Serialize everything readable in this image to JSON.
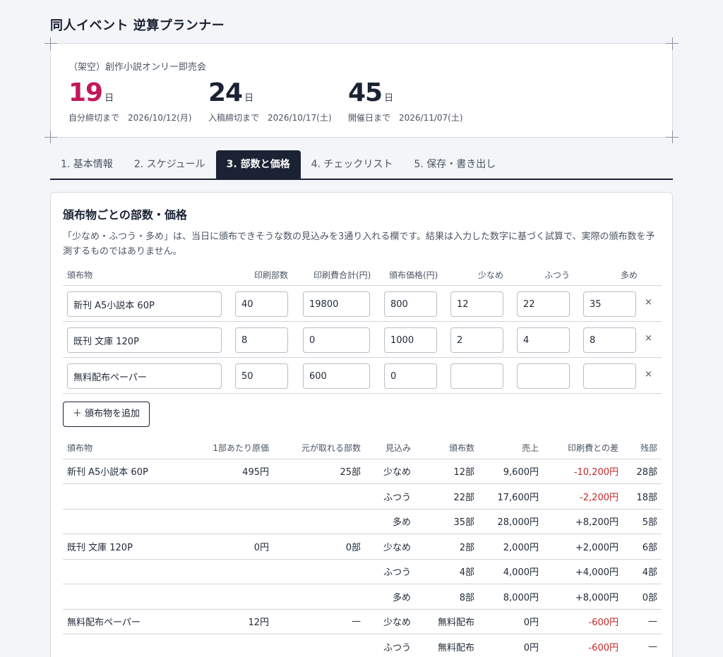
{
  "app": {
    "title": "同人イベント 逆算プランナー"
  },
  "countdown": {
    "event_name": "（架空）創作小説オンリー即売会",
    "items": [
      {
        "number": "19",
        "unit": "日",
        "caption": "自分締切まで",
        "date": "2026/10/12(月)"
      },
      {
        "number": "24",
        "unit": "日",
        "caption": "入稿締切まで",
        "date": "2026/10/17(土)"
      },
      {
        "number": "45",
        "unit": "日",
        "caption": "開催日まで",
        "date": "2026/11/07(土)"
      }
    ],
    "accent_color": "#c2185b"
  },
  "tabs": [
    {
      "label": "1. 基本情報"
    },
    {
      "label": "2. スケジュール"
    },
    {
      "label": "3. 部数と価格",
      "active": true
    },
    {
      "label": "4. チェックリスト"
    },
    {
      "label": "5. 保存・書き出し"
    }
  ],
  "section": {
    "title": "頒布物ごとの部数・価格",
    "description": "「少なめ・ふつう・多め」は、当日に頒布できそうな数の見込みを3通り入れる欄です。結果は入力した数字に基づく試算で、実際の頒布数を予測するものではありません。"
  },
  "editor": {
    "headers": {
      "item": "頒布物",
      "print_count": "印刷部数",
      "print_cost": "印刷費合計(円)",
      "price": "頒布価格(円)",
      "low": "少なめ",
      "mid": "ふつう",
      "high": "多め"
    },
    "rows": [
      {
        "name": "新刊 A5小説本 60P",
        "print_count": "40",
        "print_cost": "19800",
        "price": "800",
        "low": "12",
        "mid": "22",
        "high": "35",
        "remove": "×"
      },
      {
        "name": "既刊 文庫 120P",
        "print_count": "8",
        "print_cost": "0",
        "price": "1000",
        "low": "2",
        "mid": "4",
        "high": "8",
        "remove": "×"
      },
      {
        "name": "無料配布ペーパー",
        "print_count": "50",
        "print_cost": "600",
        "price": "0",
        "low": "",
        "mid": "",
        "high": "",
        "remove": "×"
      }
    ],
    "add_button": "＋ 頒布物を追加"
  },
  "results": {
    "headers": {
      "item": "頒布物",
      "unit_cost": "1部あたり原価",
      "break_even": "元が取れる部数",
      "scenario": "見込み",
      "count": "頒布数",
      "sales": "売上",
      "diff": "印刷費との差",
      "remaining": "残部"
    },
    "rows": [
      {
        "item": "新刊 A5小説本 60P",
        "unit_cost": "495円",
        "break_even": "25部",
        "scenario": "少なめ",
        "count": "12部",
        "sales": "9,600円",
        "diff": "-10,200円",
        "negative": true,
        "remaining": "28部"
      },
      {
        "item": "",
        "unit_cost": "",
        "break_even": "",
        "scenario": "ふつう",
        "count": "22部",
        "sales": "17,600円",
        "diff": "-2,200円",
        "negative": true,
        "remaining": "18部"
      },
      {
        "item": "",
        "unit_cost": "",
        "break_even": "",
        "scenario": "多め",
        "count": "35部",
        "sales": "28,000円",
        "diff": "+8,200円",
        "negative": false,
        "remaining": "5部"
      },
      {
        "item": "既刊 文庫 120P",
        "unit_cost": "0円",
        "break_even": "0部",
        "scenario": "少なめ",
        "count": "2部",
        "sales": "2,000円",
        "diff": "+2,000円",
        "negative": false,
        "remaining": "6部"
      },
      {
        "item": "",
        "unit_cost": "",
        "break_even": "",
        "scenario": "ふつう",
        "count": "4部",
        "sales": "4,000円",
        "diff": "+4,000円",
        "negative": false,
        "remaining": "4部"
      },
      {
        "item": "",
        "unit_cost": "",
        "break_even": "",
        "scenario": "多め",
        "count": "8部",
        "sales": "8,000円",
        "diff": "+8,000円",
        "negative": false,
        "remaining": "0部"
      },
      {
        "item": "無料配布ペーパー",
        "unit_cost": "12円",
        "break_even": "—",
        "scenario": "少なめ",
        "count": "無料配布",
        "sales": "0円",
        "diff": "-600円",
        "negative": true,
        "remaining": "—"
      },
      {
        "item": "",
        "unit_cost": "",
        "break_even": "",
        "scenario": "ふつう",
        "count": "無料配布",
        "sales": "0円",
        "diff": "-600円",
        "negative": true,
        "remaining": "—"
      }
    ],
    "negative_color": "#c62828"
  }
}
